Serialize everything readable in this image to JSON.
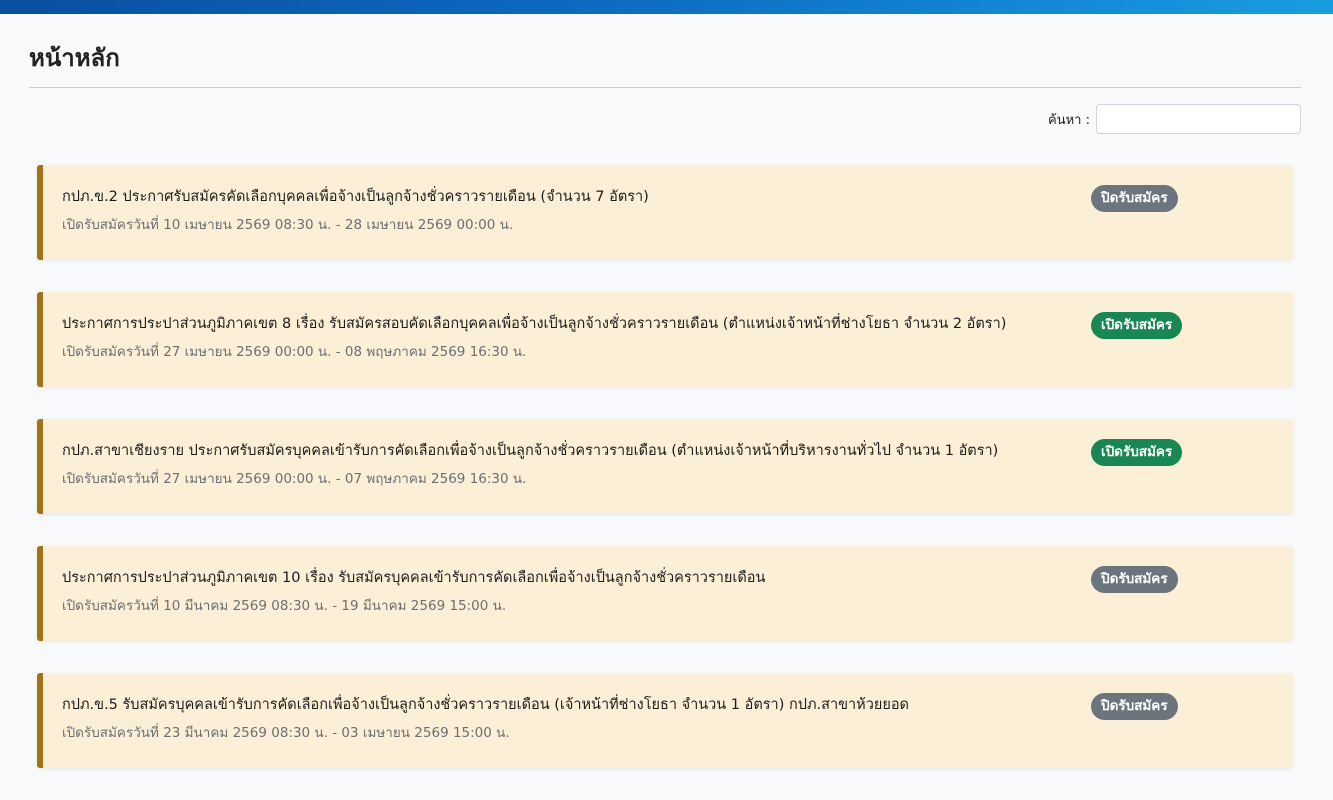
{
  "page": {
    "title": "หน้าหลัก"
  },
  "search": {
    "label": "ค้นหา :",
    "value": "",
    "placeholder": ""
  },
  "colors": {
    "accent_bar": "#0d6fc4",
    "card_bg": "#fcefd8",
    "card_border": "#a07416",
    "badge_closed": "#6c757d",
    "badge_open": "#198754"
  },
  "announcements": [
    {
      "title": "กปภ.ข.2 ประกาศรับสมัครคัดเลือกบุคคลเพื่อจ้างเป็นลูกจ้างชั่วคราวรายเดือน (จำนวน 7 อัตรา)",
      "date": "เปิดรับสมัครวันที่ 10 เมษายน 2569 08:30 น. - 28 เมษายน 2569 00:00 น.",
      "status": "ปิดรับสมัคร",
      "status_type": "closed"
    },
    {
      "title": "ประกาศการประปาส่วนภูมิภาคเขต 8 เรื่อง รับสมัครสอบคัดเลือกบุคคลเพื่อจ้างเป็นลูกจ้างชั่วคราวรายเดือน (ตำแหน่งเจ้าหน้าที่ช่างโยธา จำนวน 2 อัตรา)",
      "date": "เปิดรับสมัครวันที่ 27 เมษายน 2569 00:00 น. - 08 พฤษภาคม 2569 16:30 น.",
      "status": "เปิดรับสมัคร",
      "status_type": "open"
    },
    {
      "title": "กปภ.สาขาเชียงราย ประกาศรับสมัครบุคคลเข้ารับการคัดเลือกเพื่อจ้างเป็นลูกจ้างชั่วคราวรายเดือน (ตำแหน่งเจ้าหน้าที่บริหารงานทั่วไป จำนวน 1 อัตรา)",
      "date": "เปิดรับสมัครวันที่ 27 เมษายน 2569 00:00 น. - 07 พฤษภาคม 2569 16:30 น.",
      "status": "เปิดรับสมัคร",
      "status_type": "open"
    },
    {
      "title": "ประกาศการประปาส่วนภูมิภาคเขต 10 เรื่อง รับสมัครบุคคลเข้ารับการคัดเลือกเพื่อจ้างเป็นลูกจ้างชั่วคราวรายเดือน",
      "date": "เปิดรับสมัครวันที่ 10 มีนาคม 2569 08:30 น. - 19 มีนาคม 2569 15:00 น.",
      "status": "ปิดรับสมัคร",
      "status_type": "closed"
    },
    {
      "title": "กปภ.ข.5 รับสมัครบุคคลเข้ารับการคัดเลือกเพื่อจ้างเป็นลูกจ้างชั่วคราวรายเดือน (เจ้าหน้าที่ช่างโยธา จำนวน 1 อัตรา) กปภ.สาขาห้วยยอด",
      "date": "เปิดรับสมัครวันที่ 23 มีนาคม 2569 08:30 น. - 03 เมษายน 2569 15:00 น.",
      "status": "ปิดรับสมัคร",
      "status_type": "closed"
    }
  ]
}
